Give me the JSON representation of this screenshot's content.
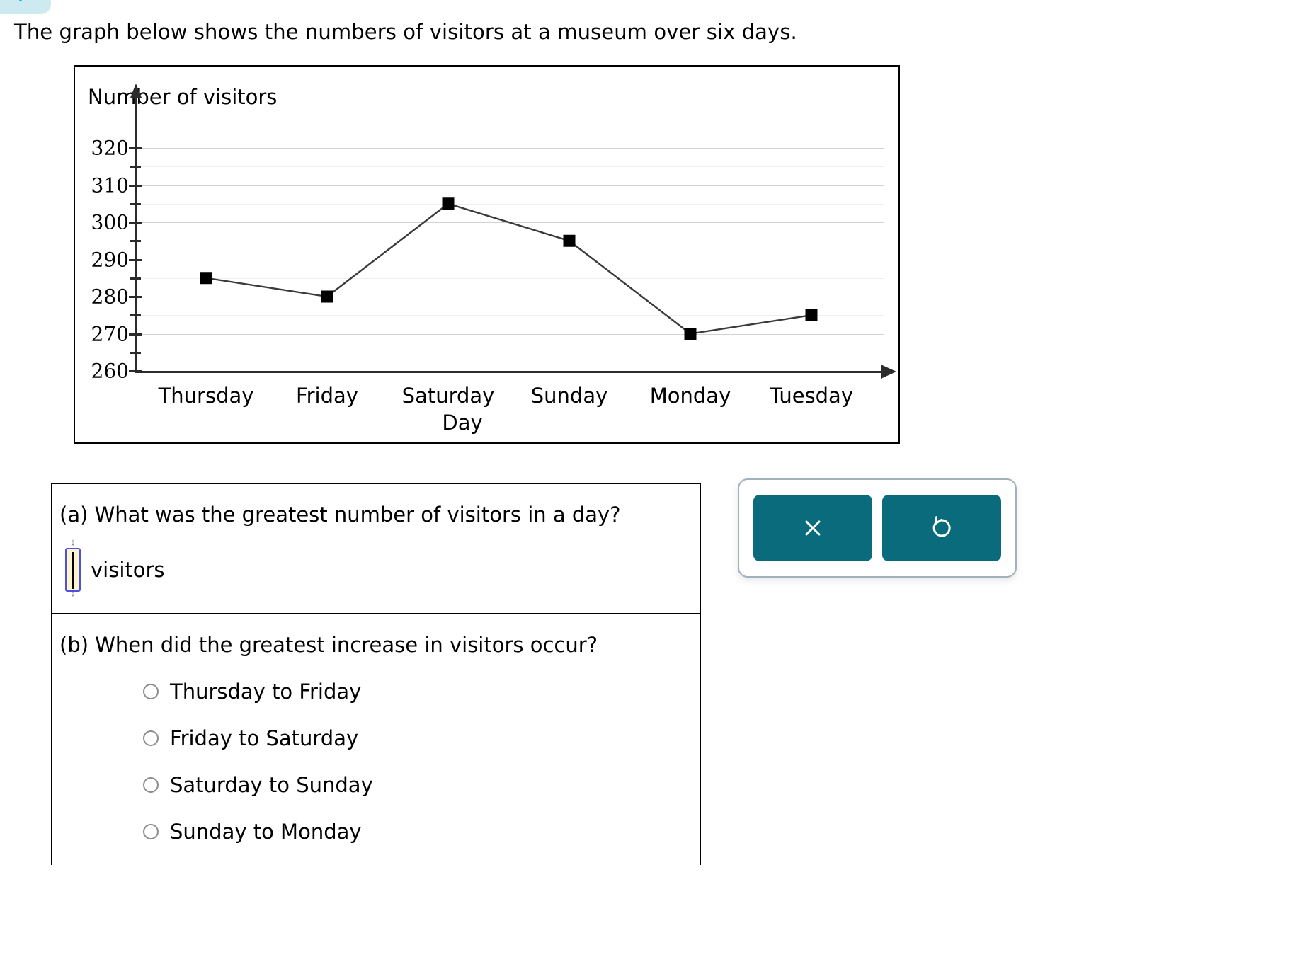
{
  "tab": {
    "icon": "chevron-down-icon",
    "accent": "#0aabc4",
    "background": "#cdeaf0"
  },
  "prompt": "The graph below shows the numbers of visitors at a museum over six days.",
  "chart_data": {
    "type": "line",
    "title": "Number of visitors",
    "xlabel": "Day",
    "ylabel": "Number of visitors",
    "categories": [
      "Thursday",
      "Friday",
      "Saturday",
      "Sunday",
      "Monday",
      "Tuesday"
    ],
    "values": [
      285,
      280,
      305,
      295,
      270,
      275
    ],
    "ylim": [
      260,
      325
    ],
    "yticks": [
      260,
      270,
      280,
      290,
      300,
      310,
      320
    ],
    "ytick_labels": [
      "260",
      "270",
      "280",
      "290",
      "300",
      "310",
      "320"
    ],
    "minor_tick_step": 5,
    "grid": true,
    "legend": "none",
    "marker": "square",
    "marker_color": "#000000",
    "line_color": "#3a3a3a"
  },
  "questions": [
    {
      "id": "a",
      "text": "(a) What was the greatest number of visitors in a day?",
      "answer": {
        "value": "",
        "unit": "visitors"
      }
    },
    {
      "id": "b",
      "text": "(b) When did the greatest increase in visitors occur?",
      "options": [
        "Thursday to Friday",
        "Friday to Saturday",
        "Saturday to Sunday",
        "Sunday to Monday"
      ]
    }
  ],
  "actions": {
    "color": "#0a6b7c",
    "buttons": [
      {
        "name": "clear-button",
        "icon": "close-icon"
      },
      {
        "name": "undo-button",
        "icon": "undo-icon"
      }
    ]
  }
}
